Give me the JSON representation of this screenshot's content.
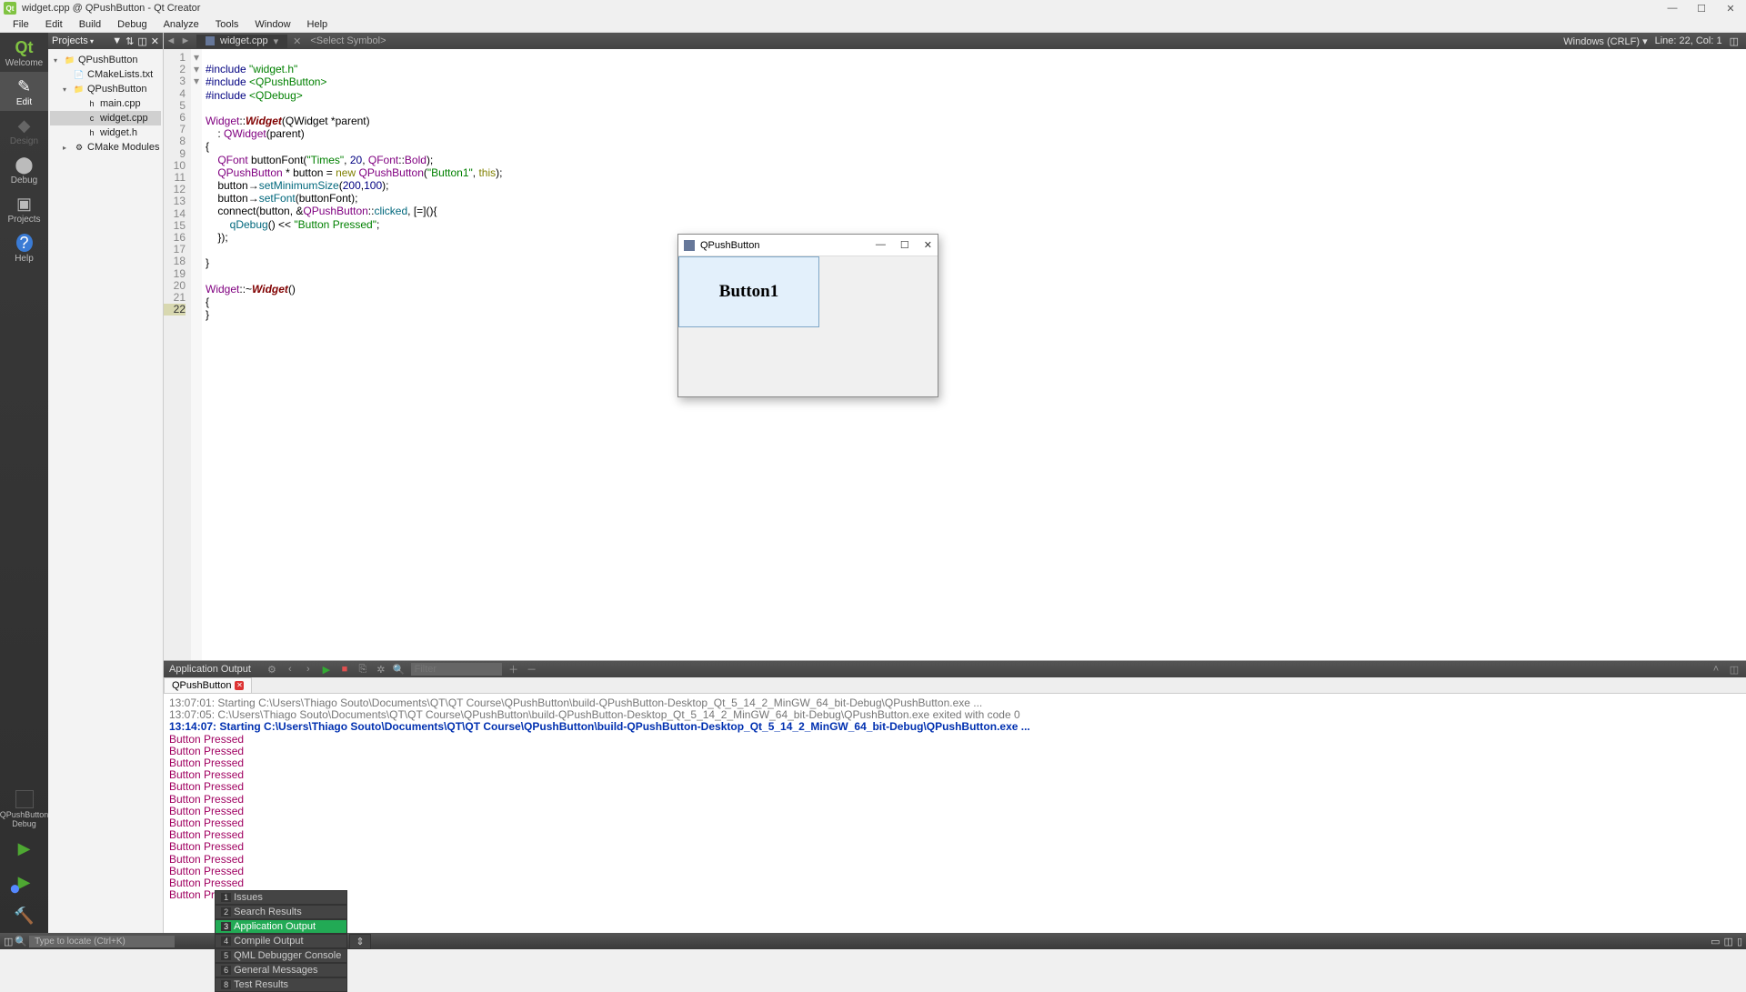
{
  "window": {
    "title": "widget.cpp @ QPushButton - Qt Creator",
    "controls": {
      "min": "—",
      "max": "☐",
      "close": "✕"
    }
  },
  "menu": [
    "File",
    "Edit",
    "Build",
    "Debug",
    "Analyze",
    "Tools",
    "Window",
    "Help"
  ],
  "modes": [
    {
      "label": "Welcome",
      "icon": "Qt"
    },
    {
      "label": "Edit",
      "icon": "📝"
    },
    {
      "label": "Design",
      "icon": "✎"
    },
    {
      "label": "Debug",
      "icon": "🐞"
    },
    {
      "label": "Projects",
      "icon": "📁"
    },
    {
      "label": "Help",
      "icon": "?"
    }
  ],
  "kit": {
    "name": "QPushButton",
    "config": "Debug"
  },
  "projTool": {
    "label": "Projects"
  },
  "tree": [
    {
      "lvl": 0,
      "caret": "▾",
      "icon": "📁",
      "label": "QPushButton"
    },
    {
      "lvl": 1,
      "caret": "",
      "icon": "📄",
      "label": "CMakeLists.txt"
    },
    {
      "lvl": 1,
      "caret": "▾",
      "icon": "📁",
      "label": "QPushButton"
    },
    {
      "lvl": 2,
      "caret": "",
      "icon": "h",
      "label": "main.cpp"
    },
    {
      "lvl": 2,
      "caret": "",
      "icon": "c",
      "label": "widget.cpp",
      "sel": true
    },
    {
      "lvl": 2,
      "caret": "",
      "icon": "h",
      "label": "widget.h"
    },
    {
      "lvl": 1,
      "caret": "▸",
      "icon": "⚙",
      "label": "CMake Modules"
    }
  ],
  "editor": {
    "nav_back": "◄",
    "nav_fwd": "►",
    "file": "widget.cpp",
    "close": "✕",
    "symbol": "<Select Symbol>",
    "encoding": "Windows (CRLF)",
    "cursor": "Line: 22, Col: 1"
  },
  "code": {
    "lines": [
      1,
      2,
      3,
      4,
      5,
      6,
      7,
      8,
      9,
      10,
      11,
      12,
      13,
      14,
      15,
      16,
      17,
      18,
      19,
      20,
      21,
      22
    ],
    "current": 22,
    "fold": {
      "6": "▾",
      "12": "▾",
      "18": "▾"
    }
  },
  "src": {
    "l1a": "#include",
    "l1b": "\"widget.h\"",
    "l2a": "#include",
    "l2b": "<QPushButton>",
    "l3a": "#include",
    "l3b": "<QDebug>",
    "l5_typ": "Widget",
    "l5_op": "::",
    "l5_fn": "Widget",
    "l5_sig": "(QWidget *parent)",
    "l6": "    : ",
    "l6_typ": "QWidget",
    "l6_r": "(parent)",
    "l7": "{",
    "l8a": "    ",
    "l8_typ": "QFont",
    "l8_b": " buttonFont(",
    "l8_s": "\"Times\"",
    "l8_c": ", ",
    "l8_n": "20",
    "l8_d": ", ",
    "l8_e": "QFont",
    "l8_f": "::",
    "l8_g": "Bold",
    "l8_h": ");",
    "l9a": "    ",
    "l9_typ": "QPushButton",
    "l9_b": " * button = ",
    "l9_kw": "new",
    "l9_c": " ",
    "l9_typ2": "QPushButton",
    "l9_d": "(",
    "l9_s": "\"Button1\"",
    "l9_e": ", ",
    "l9_kw2": "this",
    "l9_f": ");",
    "l10a": "    button→",
    "l10_fn": "setMinimumSize",
    "l10_b": "(",
    "l10_n1": "200",
    "l10_c": ",",
    "l10_n2": "100",
    "l10_d": ");",
    "l11a": "    button→",
    "l11_fn": "setFont",
    "l11_b": "(buttonFont);",
    "l12a": "    connect(button, &",
    "l12_typ": "QPushButton",
    "l12_b": "::",
    "l12_fn": "clicked",
    "l12_c": ", [=](){",
    "l13a": "        ",
    "l13_fn": "qDebug",
    "l13_b": "() << ",
    "l13_s": "\"Button Pressed\"",
    "l13_c": ";",
    "l14": "    });",
    "l15": "",
    "l16": "}",
    "l17": "",
    "l18_typ": "Widget",
    "l18_op": "::~",
    "l18_fn": "Widget",
    "l18_r": "()",
    "l19": "{",
    "l20": "}",
    "l21": "",
    "l22": ""
  },
  "output": {
    "title": "Application Output",
    "filter": "Filter",
    "tab": "QPushButton",
    "lines": [
      {
        "cls": "grey",
        "t": "13:07:01: Starting C:\\Users\\Thiago Souto\\Documents\\QT\\QT Course\\QPushButton\\build-QPushButton-Desktop_Qt_5_14_2_MinGW_64_bit-Debug\\QPushButton.exe  ..."
      },
      {
        "cls": "grey",
        "t": "13:07:05: C:\\Users\\Thiago Souto\\Documents\\QT\\QT Course\\QPushButton\\build-QPushButton-Desktop_Qt_5_14_2_MinGW_64_bit-Debug\\QPushButton.exe exited with code 0"
      },
      {
        "cls": "",
        "t": " "
      },
      {
        "cls": "blue",
        "t": "13:14:07: Starting C:\\Users\\Thiago Souto\\Documents\\QT\\QT Course\\QPushButton\\build-QPushButton-Desktop_Qt_5_14_2_MinGW_64_bit-Debug\\QPushButton.exe  ..."
      },
      {
        "cls": "red",
        "t": "Button Pressed"
      },
      {
        "cls": "red",
        "t": "Button Pressed"
      },
      {
        "cls": "red",
        "t": "Button Pressed"
      },
      {
        "cls": "red",
        "t": "Button Pressed"
      },
      {
        "cls": "red",
        "t": "Button Pressed"
      },
      {
        "cls": "red",
        "t": "Button Pressed"
      },
      {
        "cls": "red",
        "t": "Button Pressed"
      },
      {
        "cls": "red",
        "t": "Button Pressed"
      },
      {
        "cls": "red",
        "t": "Button Pressed"
      },
      {
        "cls": "red",
        "t": "Button Pressed"
      },
      {
        "cls": "red",
        "t": "Button Pressed"
      },
      {
        "cls": "red",
        "t": "Button Pressed"
      },
      {
        "cls": "red",
        "t": "Button Pressed"
      },
      {
        "cls": "red",
        "t": "Button Pressed"
      }
    ]
  },
  "status": {
    "locator": "Type to locate (Ctrl+K)",
    "items": [
      {
        "n": "1",
        "l": "Issues"
      },
      {
        "n": "2",
        "l": "Search Results"
      },
      {
        "n": "3",
        "l": "Application Output",
        "active": true
      },
      {
        "n": "4",
        "l": "Compile Output"
      },
      {
        "n": "5",
        "l": "QML Debugger Console"
      },
      {
        "n": "6",
        "l": "General Messages"
      },
      {
        "n": "8",
        "l": "Test Results"
      }
    ]
  },
  "qtwin": {
    "title": "QPushButton",
    "controls": {
      "min": "—",
      "max": "☐",
      "close": "✕"
    },
    "button": "Button1"
  }
}
